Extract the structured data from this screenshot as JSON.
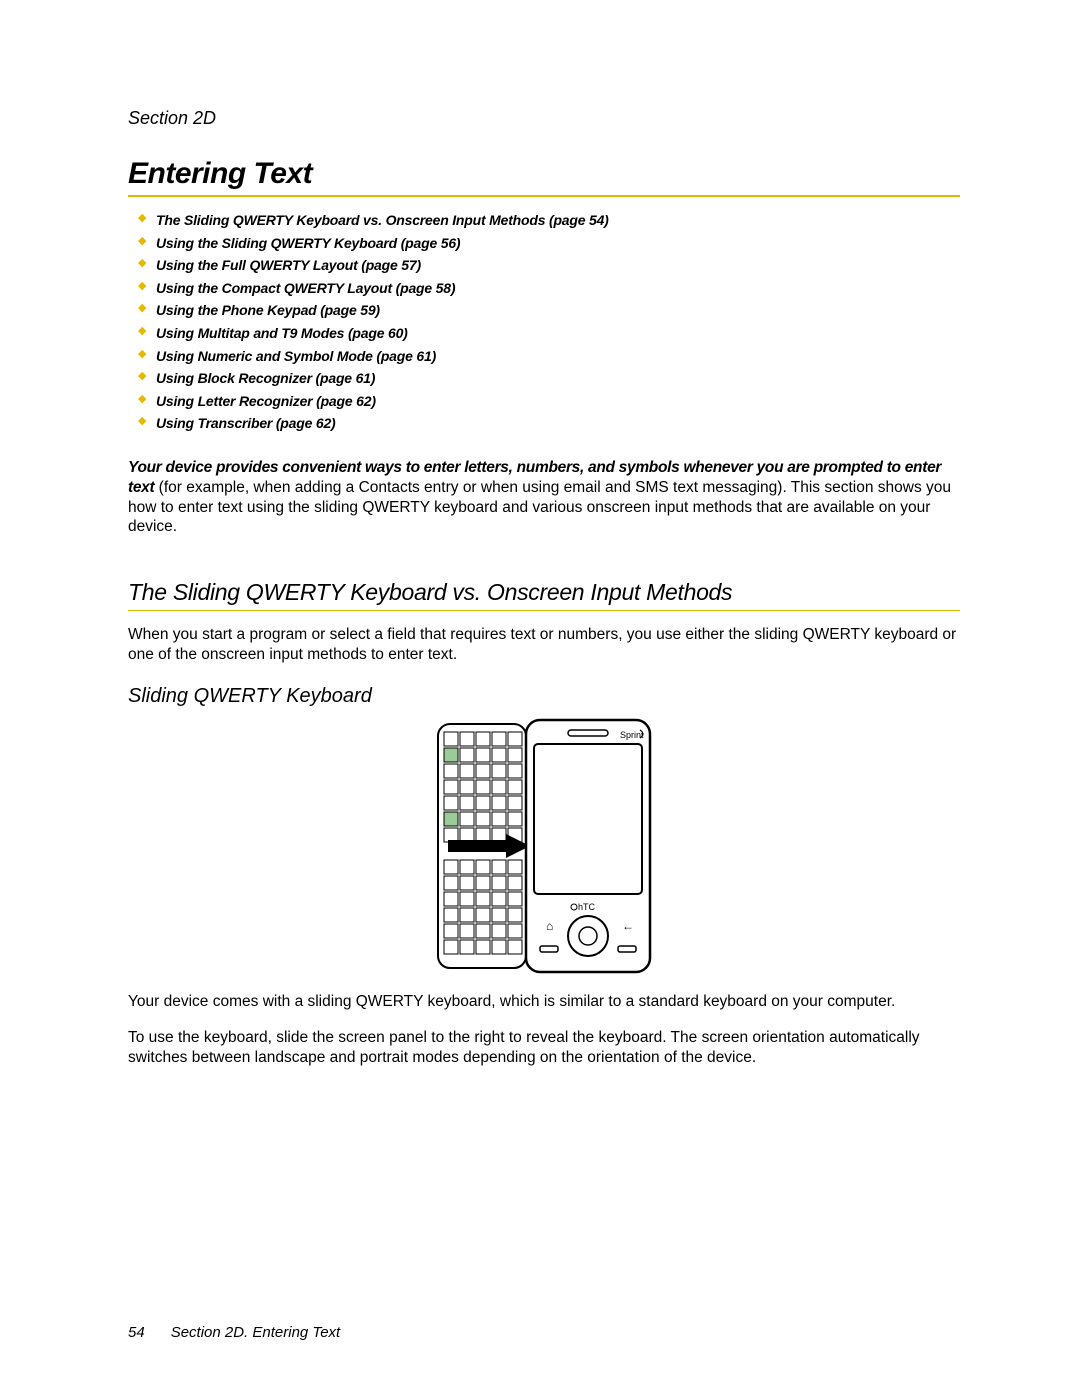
{
  "section_label": "Section 2D",
  "title": "Entering Text",
  "toc": [
    "The Sliding QWERTY Keyboard vs. Onscreen Input Methods (page 54)",
    "Using the Sliding QWERTY Keyboard (page 56)",
    "Using the Full QWERTY Layout (page 57)",
    "Using the Compact QWERTY Layout (page 58)",
    "Using the Phone Keypad (page 59)",
    "Using Multitap and T9 Modes (page 60)",
    "Using Numeric and Symbol Mode (page 61)",
    "Using Block Recognizer (page 61)",
    "Using Letter Recognizer (page 62)",
    "Using Transcriber (page 62)"
  ],
  "intro_lead": "Your device provides convenient ways to enter letters, numbers, and symbols whenever you are prompted to enter text",
  "intro_rest": " (for example, when adding a Contacts entry or when using email and SMS text messaging). This section shows you how to enter text using the sliding QWERTY keyboard and various onscreen input methods that are available on your device.",
  "h2": "The Sliding QWERTY Keyboard vs. Onscreen Input Methods",
  "p1": "When you start a program or select a field that requires text or numbers, you use either the sliding QWERTY keyboard or one of the onscreen input methods to enter text.",
  "h3": "Sliding QWERTY Keyboard",
  "device_labels": {
    "brand_top": "Sprint",
    "brand_bottom": "hTC"
  },
  "p2": "Your device comes with a sliding QWERTY keyboard, which is similar to a standard keyboard on your computer.",
  "p3": "To use the keyboard, slide the screen panel to the right to reveal the keyboard. The screen orientation automatically switches between landscape and portrait modes depending on the orientation of the device.",
  "footer_page": "54",
  "footer_text": "Section 2D. Entering Text"
}
